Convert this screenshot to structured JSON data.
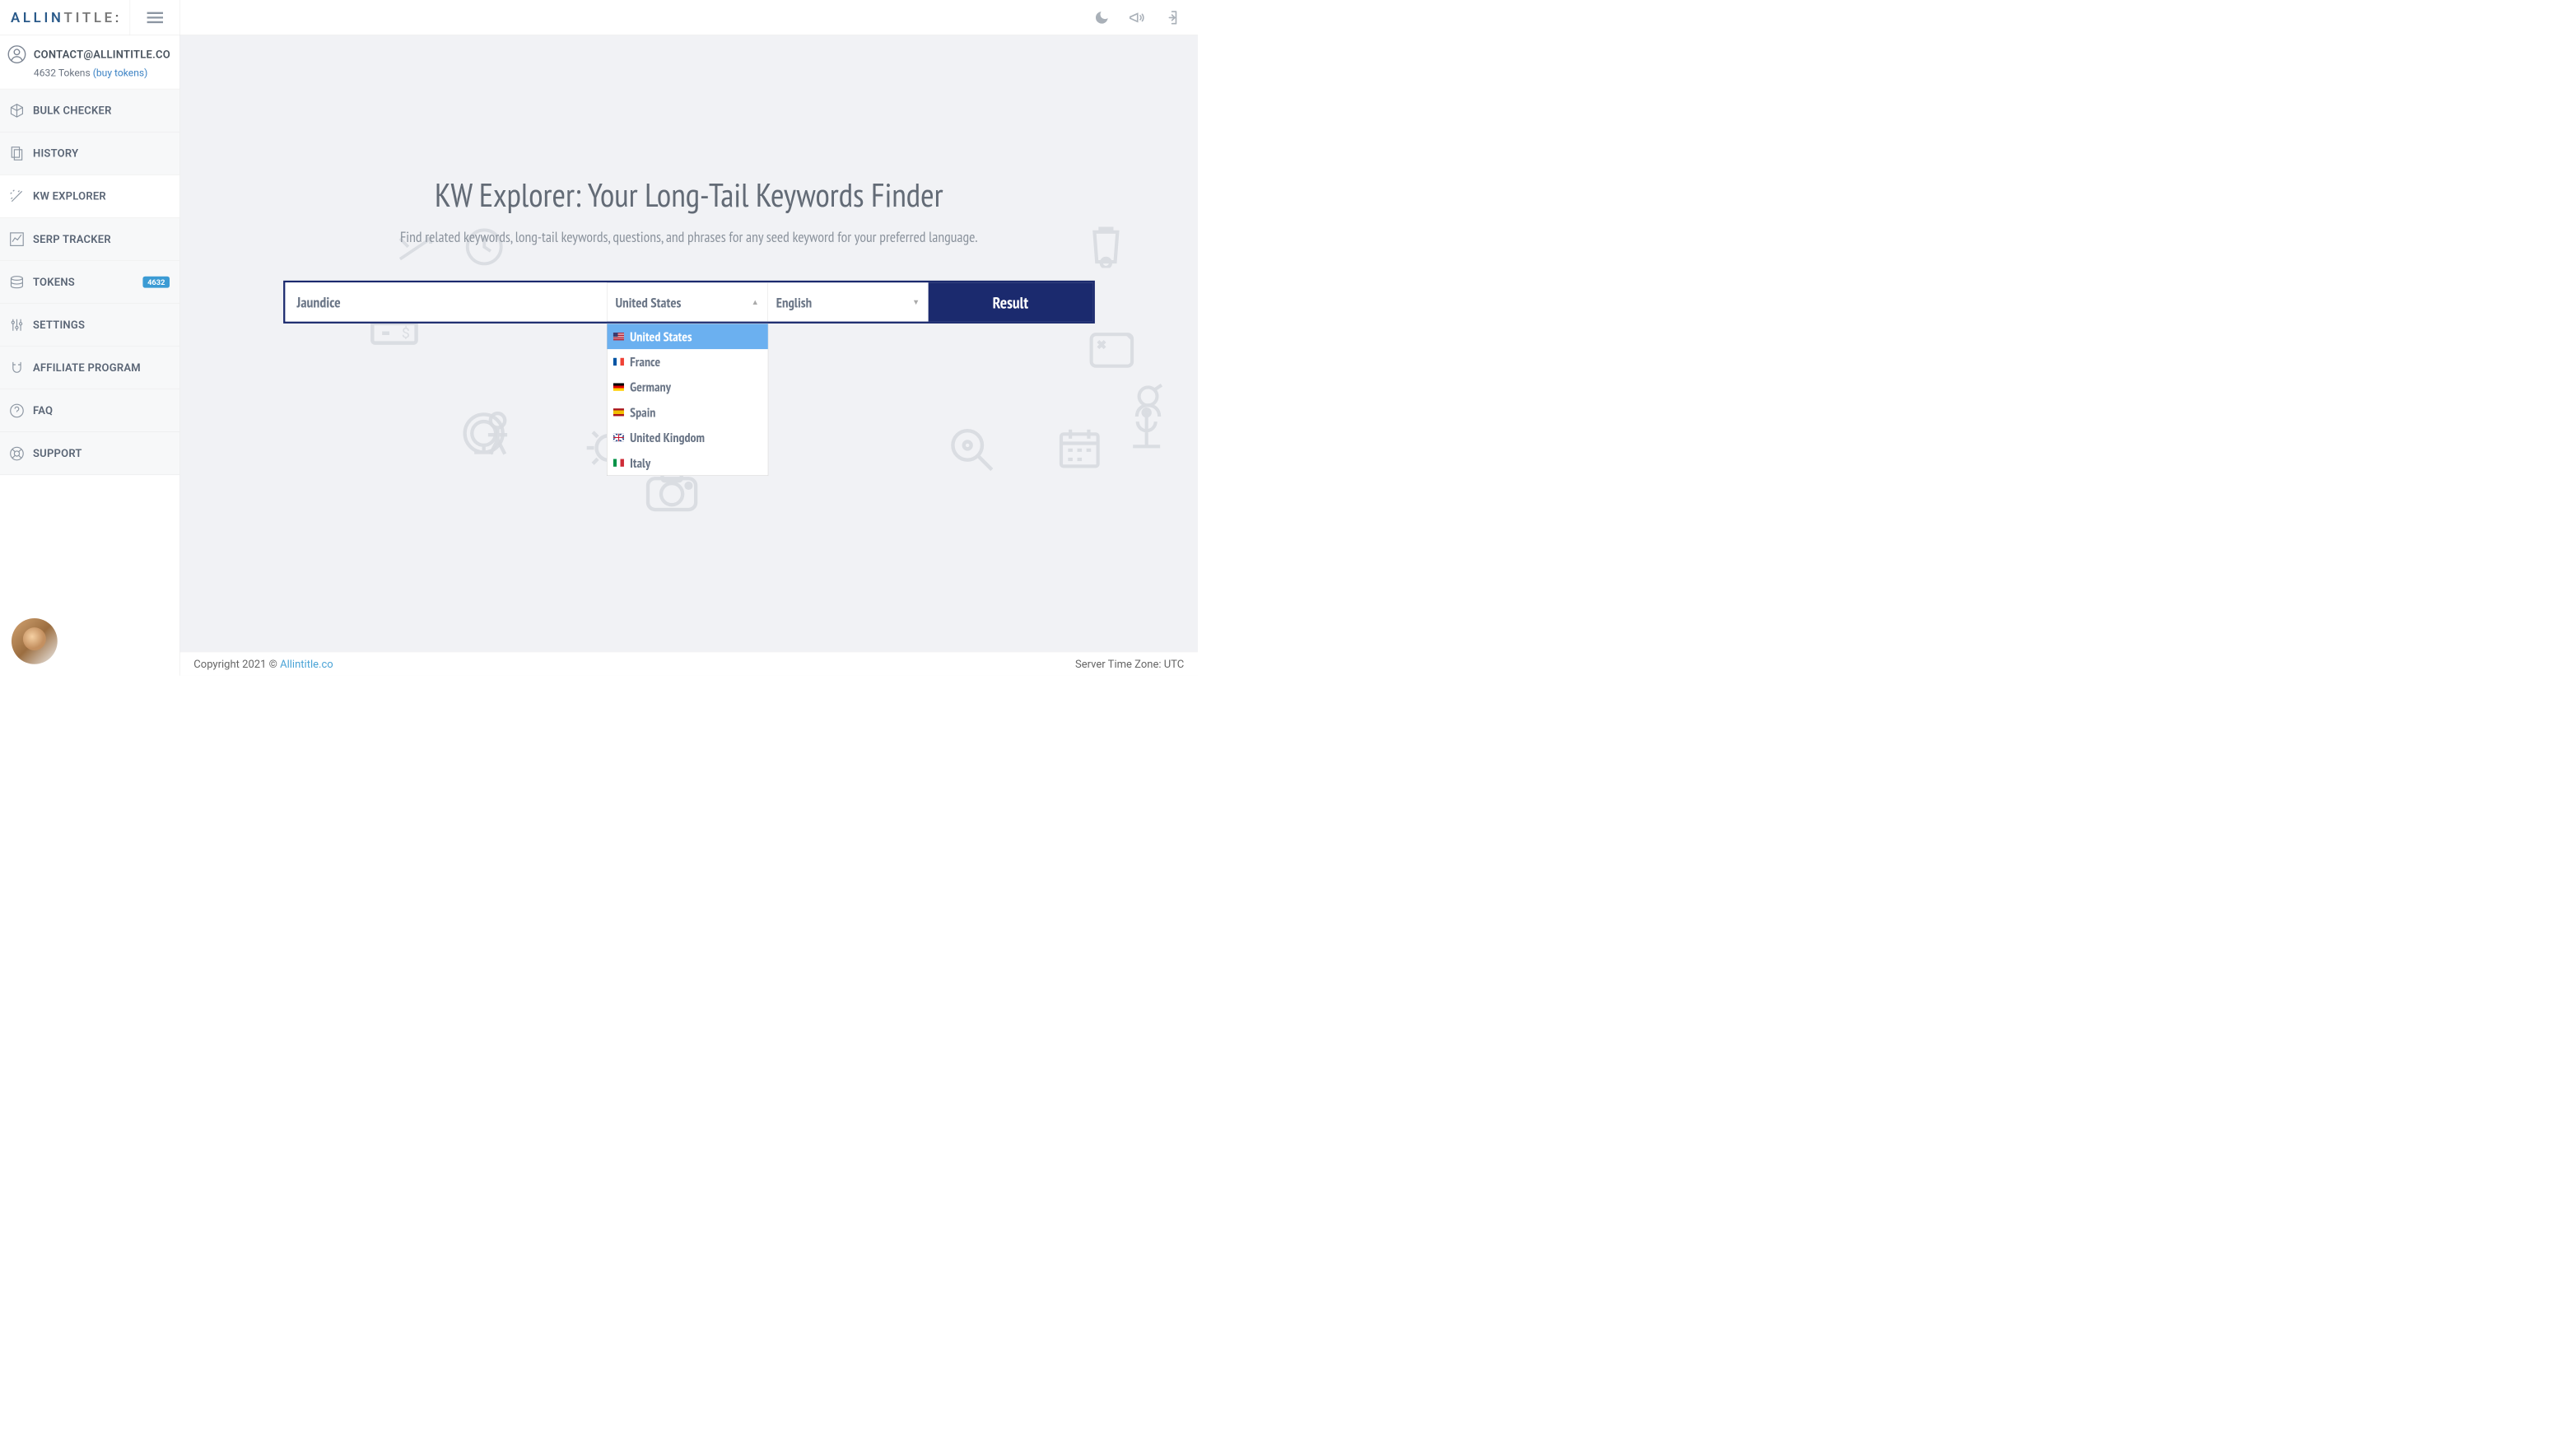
{
  "brand": {
    "pre": "ALLIN",
    "post": "TITLE",
    "colon": ":"
  },
  "user": {
    "email": "CONTACT@ALLINTITLE.CO",
    "tokens_text": "4632 Tokens ",
    "buy_link": "(buy tokens)"
  },
  "nav": {
    "bulk": "BULK CHECKER",
    "history": "HISTORY",
    "kw": "KW EXPLORER",
    "serp": "SERP TRACKER",
    "tokens": "TOKENS",
    "tokens_badge": "4632",
    "settings": "SETTINGS",
    "affiliate": "AFFILIATE PROGRAM",
    "faq": "FAQ",
    "support": "SUPPORT"
  },
  "page": {
    "title": "KW Explorer: Your Long-Tail Keywords Finder",
    "subtitle": "Find related keywords, long-tail keywords, questions, and phrases for any seed keyword for your preferred language."
  },
  "search": {
    "keyword": "Jaundice",
    "country": "United States",
    "language": "English",
    "button": "Result"
  },
  "countries": {
    "us": "United States",
    "fr": "France",
    "de": "Germany",
    "es": "Spain",
    "uk": "United Kingdom",
    "it": "Italy"
  },
  "footer": {
    "copyright": "Copyright 2021 © ",
    "brand": "Allintitle.co",
    "tz": "Server Time Zone: UTC"
  }
}
